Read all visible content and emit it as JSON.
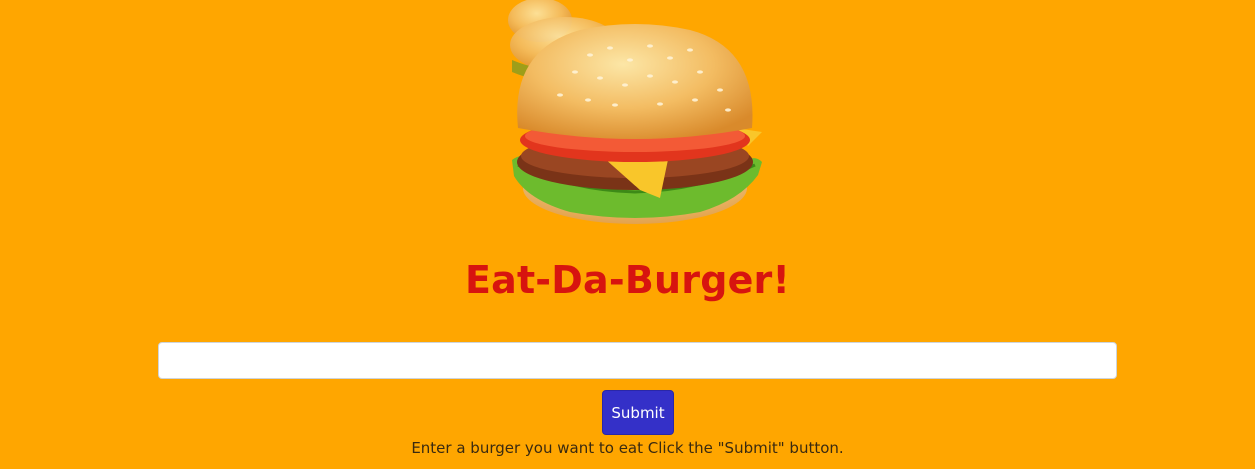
{
  "header": {
    "logo_icon": "burger-image",
    "title": "Eat-Da-Burger!"
  },
  "form": {
    "input_value": "",
    "input_placeholder": "",
    "submit_label": "Submit",
    "help_text": "Enter a burger you want to eat Click the \"Submit\" button."
  },
  "colors": {
    "background": "#FFA600",
    "title": "#D7140F",
    "button": "#3430C8"
  }
}
